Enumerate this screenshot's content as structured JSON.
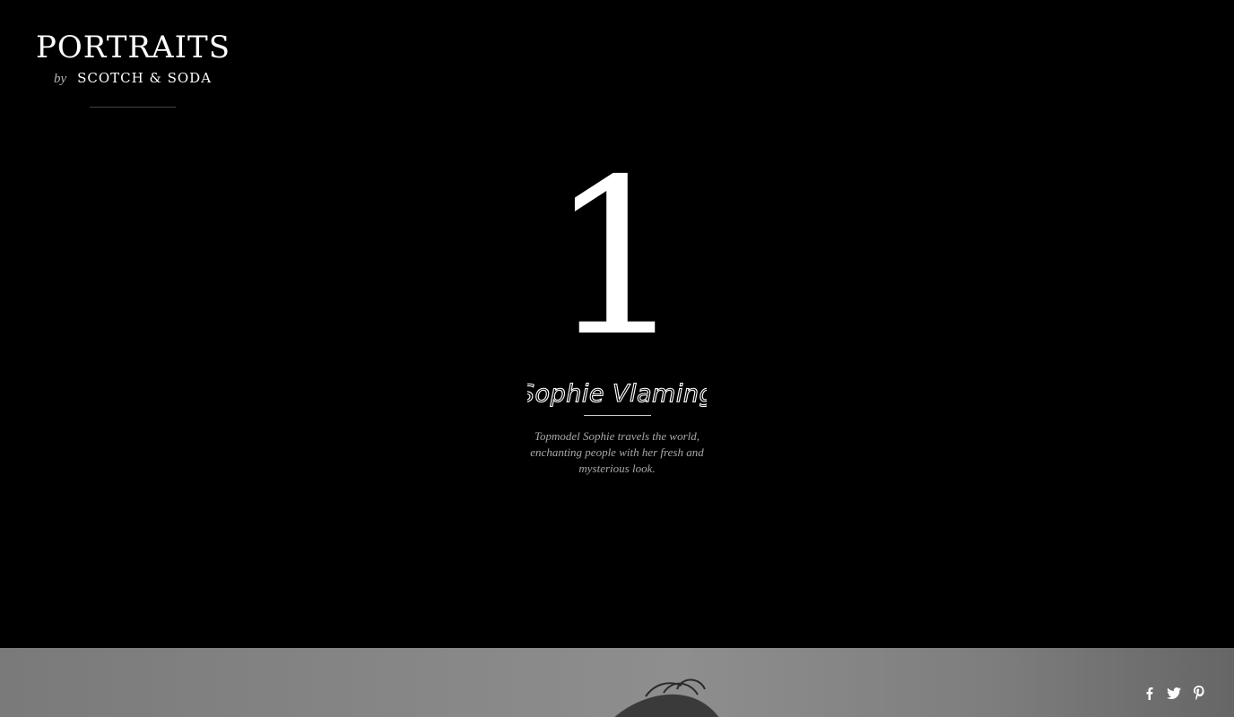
{
  "logo": {
    "title": "PORTRAITS",
    "by": "by",
    "brand": "SCOTCH & SODA"
  },
  "portrait": {
    "number": "1",
    "name": "Sophie Vlaming",
    "description": "Topmodel Sophie travels the world, enchanting people with her fresh and mysterious look."
  },
  "share": {
    "icons": [
      "facebook-icon",
      "twitter-icon",
      "pinterest-icon"
    ]
  },
  "colors": {
    "background": "#000000",
    "text": "#ffffff",
    "muted": "#a8a8a8"
  }
}
